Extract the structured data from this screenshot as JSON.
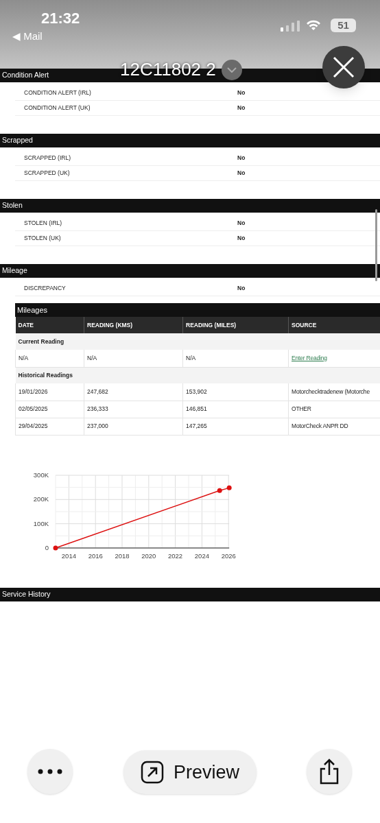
{
  "status_bar": {
    "time": "21:32",
    "back": "◀ Mail",
    "battery": "51"
  },
  "viewer": {
    "title": "12C11802 2"
  },
  "sections": [
    {
      "title": "Condition Alert",
      "rows": [
        {
          "label": "CONDITION ALERT (IRL)",
          "value": "No"
        },
        {
          "label": "CONDITION ALERT (UK)",
          "value": "No"
        }
      ]
    },
    {
      "title": "Scrapped",
      "rows": [
        {
          "label": "SCRAPPED (IRL)",
          "value": "No"
        },
        {
          "label": "SCRAPPED (UK)",
          "value": "No"
        }
      ]
    },
    {
      "title": "Stolen",
      "rows": [
        {
          "label": "STOLEN (IRL)",
          "value": "No"
        },
        {
          "label": "STOLEN (UK)",
          "value": "No"
        }
      ]
    },
    {
      "title": "Mileage",
      "rows": [
        {
          "label": "DISCREPANCY",
          "value": "No"
        }
      ]
    }
  ],
  "mileages": {
    "title": "Mileages",
    "columns": [
      "DATE",
      "READING (KMS)",
      "READING (MILES)",
      "SOURCE"
    ],
    "groups": [
      {
        "title": "Current Reading",
        "rows": [
          {
            "cells": [
              "N/A",
              "N/A",
              "N/A"
            ],
            "source": "Enter Reading",
            "kind": "link"
          }
        ]
      },
      {
        "title": "Historical Readings",
        "rows": [
          {
            "cells": [
              "19/01/2026",
              "247,682",
              "153,902"
            ],
            "source": "Motorchecktradenew (Motorche",
            "kind": "text"
          },
          {
            "cells": [
              "02/05/2025",
              "236,333",
              "146,851"
            ],
            "source": "OTHER",
            "kind": "text"
          },
          {
            "cells": [
              "29/04/2025",
              "237,000",
              "147,265"
            ],
            "source": "MotorCheck ANPR DD",
            "kind": "text"
          }
        ]
      }
    ]
  },
  "chart": {
    "chart_data": {
      "type": "line",
      "x": [
        2013,
        2025.33,
        2026.05
      ],
      "grid": true,
      "series": [
        {
          "color": "#dd1111",
          "marker": true,
          "values": [
            0,
            237000,
            248000
          ]
        }
      ],
      "xlim": [
        2013,
        2026.05
      ],
      "ylim": [
        0,
        300000
      ],
      "xticks": [
        2014,
        2016,
        2018,
        2020,
        2022,
        2024,
        2026
      ],
      "yticks": [
        {
          "value": 0,
          "label": "0"
        },
        {
          "value": 100000,
          "label": "100K"
        },
        {
          "value": 200000,
          "label": "200K"
        },
        {
          "value": 300000,
          "label": "300K"
        }
      ]
    }
  },
  "next_section": "Service History",
  "toolbar": {
    "preview": "Preview"
  }
}
